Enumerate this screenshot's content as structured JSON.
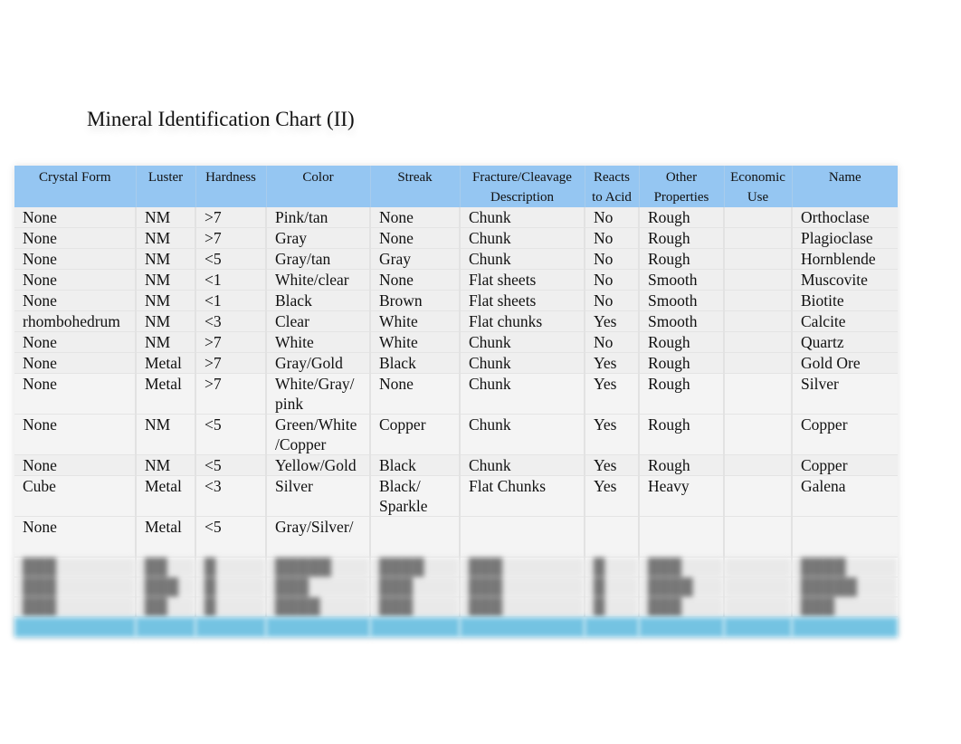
{
  "document": {
    "title": "Mineral Identification Chart (II)"
  },
  "table": {
    "headers": [
      "Crystal Form",
      "Luster",
      "Hardness",
      "Color",
      "Streak",
      "Fracture/Cleavage Description",
      "Reacts to Acid",
      "Other Properties",
      "Economic Use",
      "Name"
    ],
    "rows": [
      {
        "crystal_form": "None",
        "luster": "NM",
        "hardness": ">7",
        "color": "Pink/tan",
        "streak": "None",
        "fracture": "Chunk",
        "acid": "No",
        "other": "Rough",
        "economic_use": "",
        "name": "Orthoclase"
      },
      {
        "crystal_form": "None",
        "luster": "NM",
        "hardness": ">7",
        "color": "Gray",
        "streak": "None",
        "fracture": "Chunk",
        "acid": "No",
        "other": "Rough",
        "economic_use": "",
        "name": "Plagioclase"
      },
      {
        "crystal_form": "None",
        "luster": "NM",
        "hardness": "<5",
        "color": "Gray/tan",
        "streak": "Gray",
        "fracture": "Chunk",
        "acid": "No",
        "other": "Rough",
        "economic_use": "",
        "name": "Hornblende"
      },
      {
        "crystal_form": "None",
        "luster": "NM",
        "hardness": "<1",
        "color": "White/clear",
        "streak": "None",
        "fracture": "Flat sheets",
        "acid": "No",
        "other": "Smooth",
        "economic_use": "",
        "name": "Muscovite"
      },
      {
        "crystal_form": "None",
        "luster": "NM",
        "hardness": "<1",
        "color": "Black",
        "streak": "Brown",
        "fracture": "Flat sheets",
        "acid": "No",
        "other": "Smooth",
        "economic_use": "",
        "name": "Biotite"
      },
      {
        "crystal_form": "rhombohedrum",
        "luster": "NM",
        "hardness": "<3",
        "color": "Clear",
        "streak": "White",
        "fracture": "Flat chunks",
        "acid": "Yes",
        "other": "Smooth",
        "economic_use": "",
        "name": "Calcite"
      },
      {
        "crystal_form": "None",
        "luster": "NM",
        "hardness": ">7",
        "color": "White",
        "streak": "White",
        "fracture": "Chunk",
        "acid": "No",
        "other": "Rough",
        "economic_use": "",
        "name": "Quartz"
      },
      {
        "crystal_form": "None",
        "luster": "Metal",
        "hardness": ">7",
        "color": "Gray/Gold",
        "streak": "Black",
        "fracture": "Chunk",
        "acid": "Yes",
        "other": "Rough",
        "economic_use": "",
        "name": "Gold Ore"
      },
      {
        "crystal_form": "None",
        "luster": "Metal",
        "hardness": ">7",
        "color": "White/Gray/ pink",
        "streak": "None",
        "fracture": "Chunk",
        "acid": "Yes",
        "other": "Rough",
        "economic_use": "",
        "name": "Silver"
      },
      {
        "crystal_form": "None",
        "luster": "NM",
        "hardness": "<5",
        "color": "Green/White /Copper",
        "streak": "Copper",
        "fracture": "Chunk",
        "acid": "Yes",
        "other": "Rough",
        "economic_use": "",
        "name": "Copper"
      },
      {
        "crystal_form": "None",
        "luster": "NM",
        "hardness": "<5",
        "color": "Yellow/Gold",
        "streak": "Black",
        "fracture": "Chunk",
        "acid": "Yes",
        "other": "Rough",
        "economic_use": "",
        "name": "Copper"
      },
      {
        "crystal_form": "Cube",
        "luster": "Metal",
        "hardness": "<3",
        "color": "Silver",
        "streak": "Black/ Sparkle",
        "fracture": "Flat Chunks",
        "acid": "Yes",
        "other": "Heavy",
        "economic_use": "",
        "name": "Galena"
      },
      {
        "crystal_form": "None",
        "luster": "Metal",
        "hardness": "<5",
        "color": "Gray/Silver/",
        "streak": "",
        "fracture": "",
        "acid": "",
        "other": "",
        "economic_use": "",
        "name": ""
      }
    ]
  }
}
